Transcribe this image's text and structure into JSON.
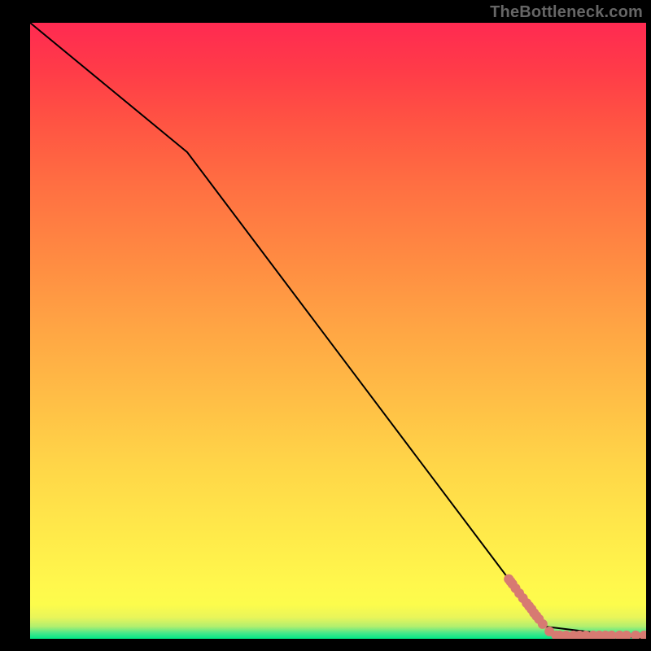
{
  "watermark": "TheBottleneck.com",
  "chart_data": {
    "type": "line",
    "title": "",
    "xlabel": "",
    "ylabel": "",
    "xlim": [
      0,
      100
    ],
    "ylim": [
      0,
      100
    ],
    "grid": false,
    "legend": false,
    "curve_xy": [
      [
        0,
        100
      ],
      [
        25.5,
        79
      ],
      [
        83.5,
        2
      ],
      [
        100,
        0
      ]
    ],
    "markers_xy": [
      [
        77.7,
        9.7
      ],
      [
        78.0,
        9.3
      ],
      [
        78.3,
        8.9
      ],
      [
        78.8,
        8.2
      ],
      [
        79.4,
        7.4
      ],
      [
        80.0,
        6.6
      ],
      [
        80.6,
        5.8
      ],
      [
        81.0,
        5.3
      ],
      [
        81.4,
        4.8
      ],
      [
        81.8,
        4.2
      ],
      [
        82.2,
        3.7
      ],
      [
        82.6,
        3.2
      ],
      [
        83.2,
        2.4
      ],
      [
        84.3,
        1.2
      ],
      [
        85.4,
        0.55
      ],
      [
        86.0,
        0.55
      ],
      [
        87.0,
        0.55
      ],
      [
        88.2,
        0.55
      ],
      [
        89.2,
        0.55
      ],
      [
        90.2,
        0.55
      ],
      [
        91.4,
        0.55
      ],
      [
        92.4,
        0.55
      ],
      [
        93.4,
        0.55
      ],
      [
        94.4,
        0.55
      ],
      [
        95.7,
        0.55
      ],
      [
        96.8,
        0.55
      ],
      [
        98.3,
        0.55
      ],
      [
        99.7,
        0.55
      ]
    ],
    "ticks": {
      "x": [],
      "y": []
    }
  },
  "colors": {
    "curve": "#000000",
    "marker_fill": "#d77a72",
    "marker_stroke": "#d77a72"
  }
}
